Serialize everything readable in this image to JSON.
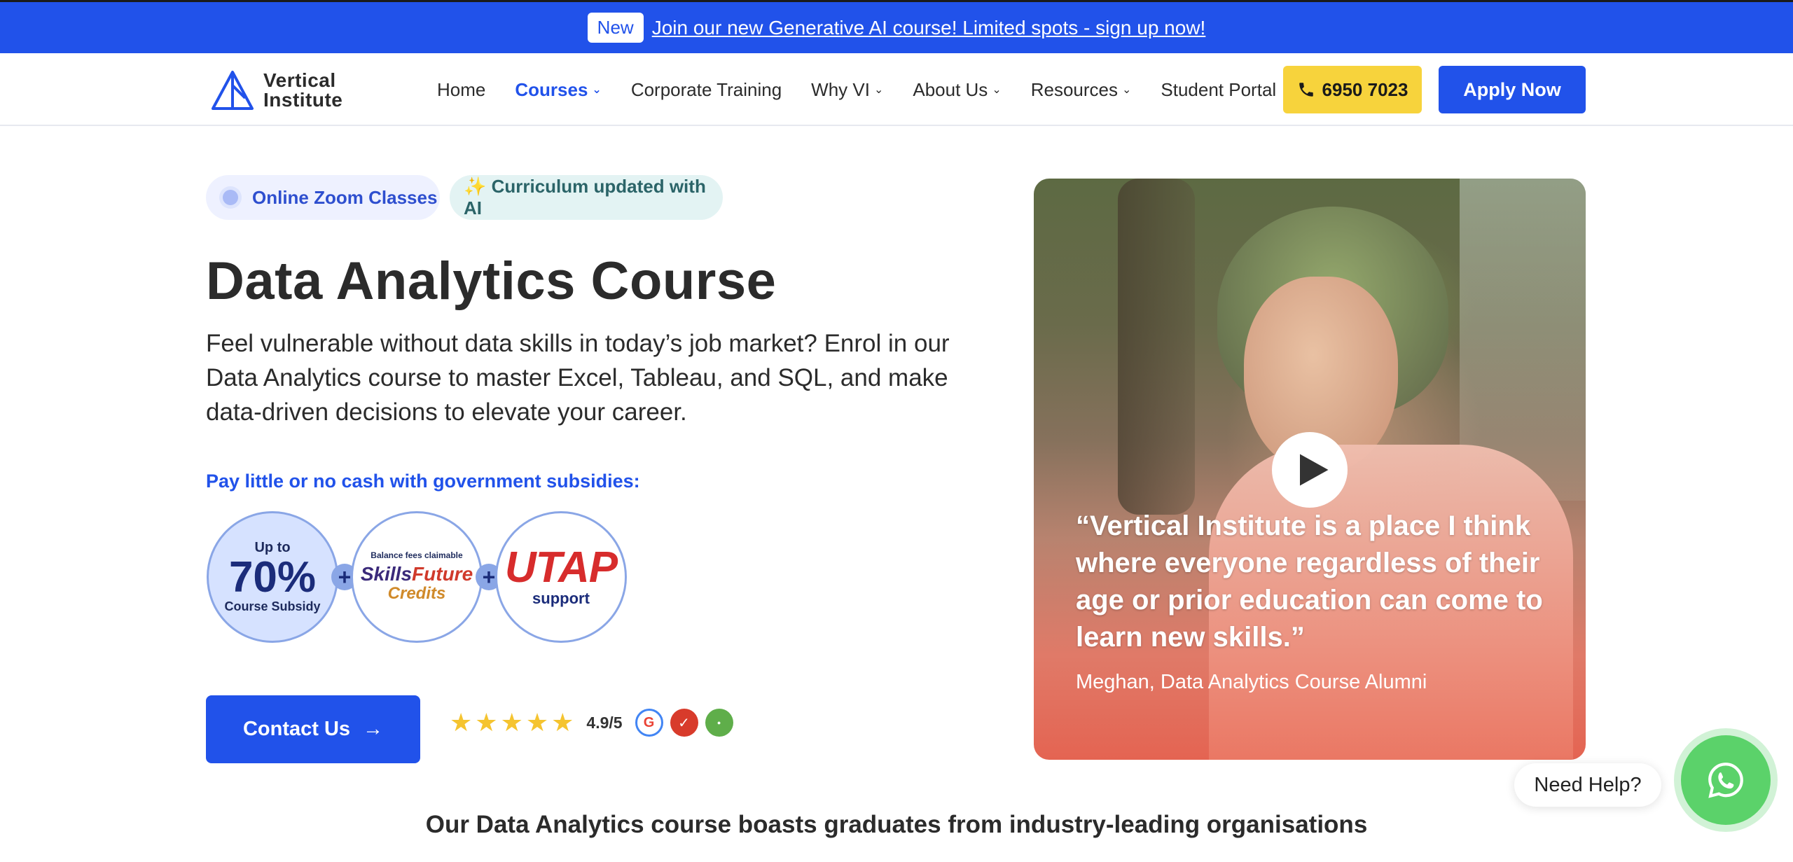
{
  "announcement": {
    "badge": "New",
    "link": "Join our new Generative AI course! Limited spots - sign up now!"
  },
  "nav": {
    "logo_line1": "Vertical",
    "logo_line2": "Institute",
    "items": [
      {
        "label": "Home",
        "dropdown": false,
        "active": false
      },
      {
        "label": "Courses",
        "dropdown": true,
        "active": true
      },
      {
        "label": "Corporate Training",
        "dropdown": false,
        "active": false
      },
      {
        "label": "Why VI",
        "dropdown": true,
        "active": false
      },
      {
        "label": "About Us",
        "dropdown": true,
        "active": false
      },
      {
        "label": "Resources",
        "dropdown": true,
        "active": false
      },
      {
        "label": "Student Portal",
        "dropdown": false,
        "active": false
      }
    ],
    "phone": "6950 7023",
    "apply": "Apply Now"
  },
  "hero": {
    "pill_zoom": "Online Zoom Classes",
    "pill_ai": "✨ Curriculum updated with AI",
    "title": "Data Analytics Course",
    "description": "Feel vulnerable without data skills in today’s job market? Enrol in our Data Analytics course to master Excel, Tableau, and SQL, and make data-driven decisions to elevate your career.",
    "subsidy_label": "Pay little or no cash with government subsidies:",
    "subsidy": {
      "c1_top": "Up to",
      "c1_big": "70%",
      "c1_bottom": "Course Subsidy",
      "c2_top": "Balance fees claimable",
      "c2_skills": "Skills",
      "c2_future": "Future",
      "c2_credits": "Credits",
      "c3_big": "UTAP",
      "c3_bottom": "support",
      "plus": "+"
    },
    "contact": "Contact Us",
    "contact_arrow": "→",
    "rating": {
      "stars": 5,
      "score": "4.9/5"
    }
  },
  "video": {
    "quote": "“Vertical Institute is a place I think where everyone regardless of their age or prior education can come to learn new skills.”",
    "author": "Meghan, Data Analytics Course Alumni"
  },
  "orgs_heading": "Our Data Analytics course boasts graduates from industry-leading organisations",
  "help": {
    "label": "Need Help?"
  },
  "colors": {
    "primary": "#2152ea",
    "phone_button": "#f7d33c",
    "whatsapp": "#5bd26a",
    "star": "#f5c430"
  },
  "icons": [
    "logo-icon",
    "chevron-down-icon",
    "phone-icon",
    "arrow-right-icon",
    "star-icon",
    "google-icon",
    "review-site-icon",
    "course-review-icon",
    "play-icon",
    "whatsapp-icon"
  ]
}
